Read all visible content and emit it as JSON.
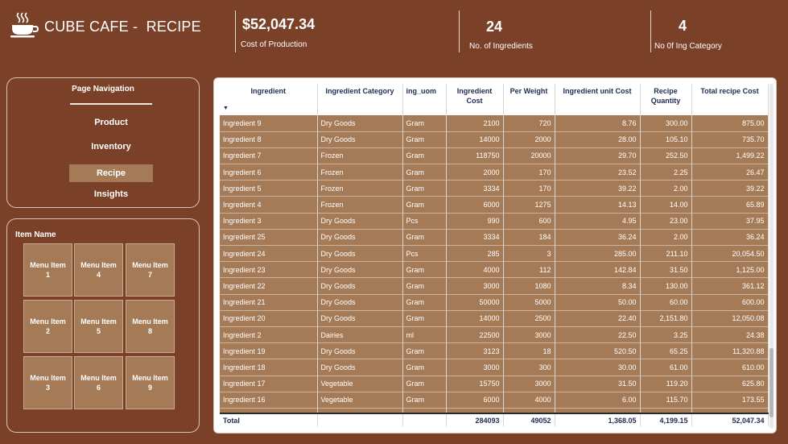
{
  "header": {
    "title": "CUBE CAFE -  RECIPE",
    "logo_icon": "coffee-cup-icon",
    "kpis": [
      {
        "value": "$52,047.34",
        "label": "Cost of Production"
      },
      {
        "value": "24",
        "label": "No. of Ingredients"
      },
      {
        "value": "4",
        "label": "No 0f Ing Category"
      }
    ]
  },
  "nav": {
    "title": "Page Navigation",
    "items": [
      {
        "label": "Product"
      },
      {
        "label": "Inventory"
      },
      {
        "label": "Recipe"
      },
      {
        "label": "Insights"
      }
    ],
    "active": "Recipe"
  },
  "item_filter": {
    "title": "Item Name",
    "items": [
      {
        "label": "Menu Item\n1"
      },
      {
        "label": "Menu Item\n4"
      },
      {
        "label": "Menu Item\n7"
      },
      {
        "label": "Menu Item\n2"
      },
      {
        "label": "Menu Item\n5"
      },
      {
        "label": "Menu Item\n8"
      },
      {
        "label": "Menu Item\n3"
      },
      {
        "label": "Menu Item\n6"
      },
      {
        "label": "Menu Item\n9"
      }
    ]
  },
  "table": {
    "columns": [
      "Ingredient",
      "Ingredient Category",
      "ing_uom",
      "Ingredient Cost",
      "Per Weight",
      "Ingredient unit Cost",
      "Recipe Quantity",
      "Total recipe Cost"
    ],
    "rows": [
      [
        "Ingredient 9",
        "Dry Goods",
        "Gram",
        "2100",
        "720",
        "8.76",
        "300.00",
        "875.00"
      ],
      [
        "Ingredient 8",
        "Dry Goods",
        "Gram",
        "14000",
        "2000",
        "28.00",
        "105.10",
        "735.70"
      ],
      [
        "Ingredient 7",
        "Frozen",
        "Gram",
        "118750",
        "20000",
        "29.70",
        "252.50",
        "1,499.22"
      ],
      [
        "Ingredient 6",
        "Frozen",
        "Gram",
        "2000",
        "170",
        "23.52",
        "2.25",
        "26.47"
      ],
      [
        "Ingredient 5",
        "Frozen",
        "Gram",
        "3334",
        "170",
        "39.22",
        "2.00",
        "39.22"
      ],
      [
        "Ingredient 4",
        "Frozen",
        "Gram",
        "6000",
        "1275",
        "14.13",
        "14.00",
        "65.89"
      ],
      [
        "Ingredient 3",
        "Dry Goods",
        "Pcs",
        "990",
        "600",
        "4.95",
        "23.00",
        "37.95"
      ],
      [
        "Ingredient 25",
        "Dry Goods",
        "Gram",
        "3334",
        "184",
        "36.24",
        "2.00",
        "36.24"
      ],
      [
        "Ingredient 24",
        "Dry Goods",
        "Pcs",
        "285",
        "3",
        "285.00",
        "211.10",
        "20,054.50"
      ],
      [
        "Ingredient 23",
        "Dry Goods",
        "Gram",
        "4000",
        "112",
        "142.84",
        "31.50",
        "1,125.00"
      ],
      [
        "Ingredient 22",
        "Dry Goods",
        "Gram",
        "3000",
        "1080",
        "8.34",
        "130.00",
        "361.12"
      ],
      [
        "Ingredient 21",
        "Dry Goods",
        "Gram",
        "50000",
        "5000",
        "50.00",
        "60.00",
        "600.00"
      ],
      [
        "Ingredient 20",
        "Dry Goods",
        "Gram",
        "14000",
        "2500",
        "22.40",
        "2,151.80",
        "12,050.08"
      ],
      [
        "Ingredient 2",
        "Dairies",
        "ml",
        "22500",
        "3000",
        "22.50",
        "3.25",
        "24.38"
      ],
      [
        "Ingredient 19",
        "Dry Goods",
        "Gram",
        "3123",
        "18",
        "520.50",
        "65.25",
        "11,320.88"
      ],
      [
        "Ingredient 18",
        "Dry Goods",
        "Gram",
        "3000",
        "300",
        "30.00",
        "61.00",
        "610.00"
      ],
      [
        "Ingredient 17",
        "Vegetable",
        "Gram",
        "15750",
        "3000",
        "31.50",
        "119.20",
        "625.80"
      ],
      [
        "Ingredient 16",
        "Vegetable",
        "Gram",
        "6000",
        "4000",
        "6.00",
        "115.70",
        "173.55"
      ]
    ],
    "total": [
      "Total",
      "",
      "",
      "284093",
      "49052",
      "1,368.05",
      "4,199.15",
      "52,047.34"
    ]
  },
  "colors": {
    "background": "#7a4128",
    "tile": "#a57a56",
    "header_text": "#1e2c52"
  }
}
